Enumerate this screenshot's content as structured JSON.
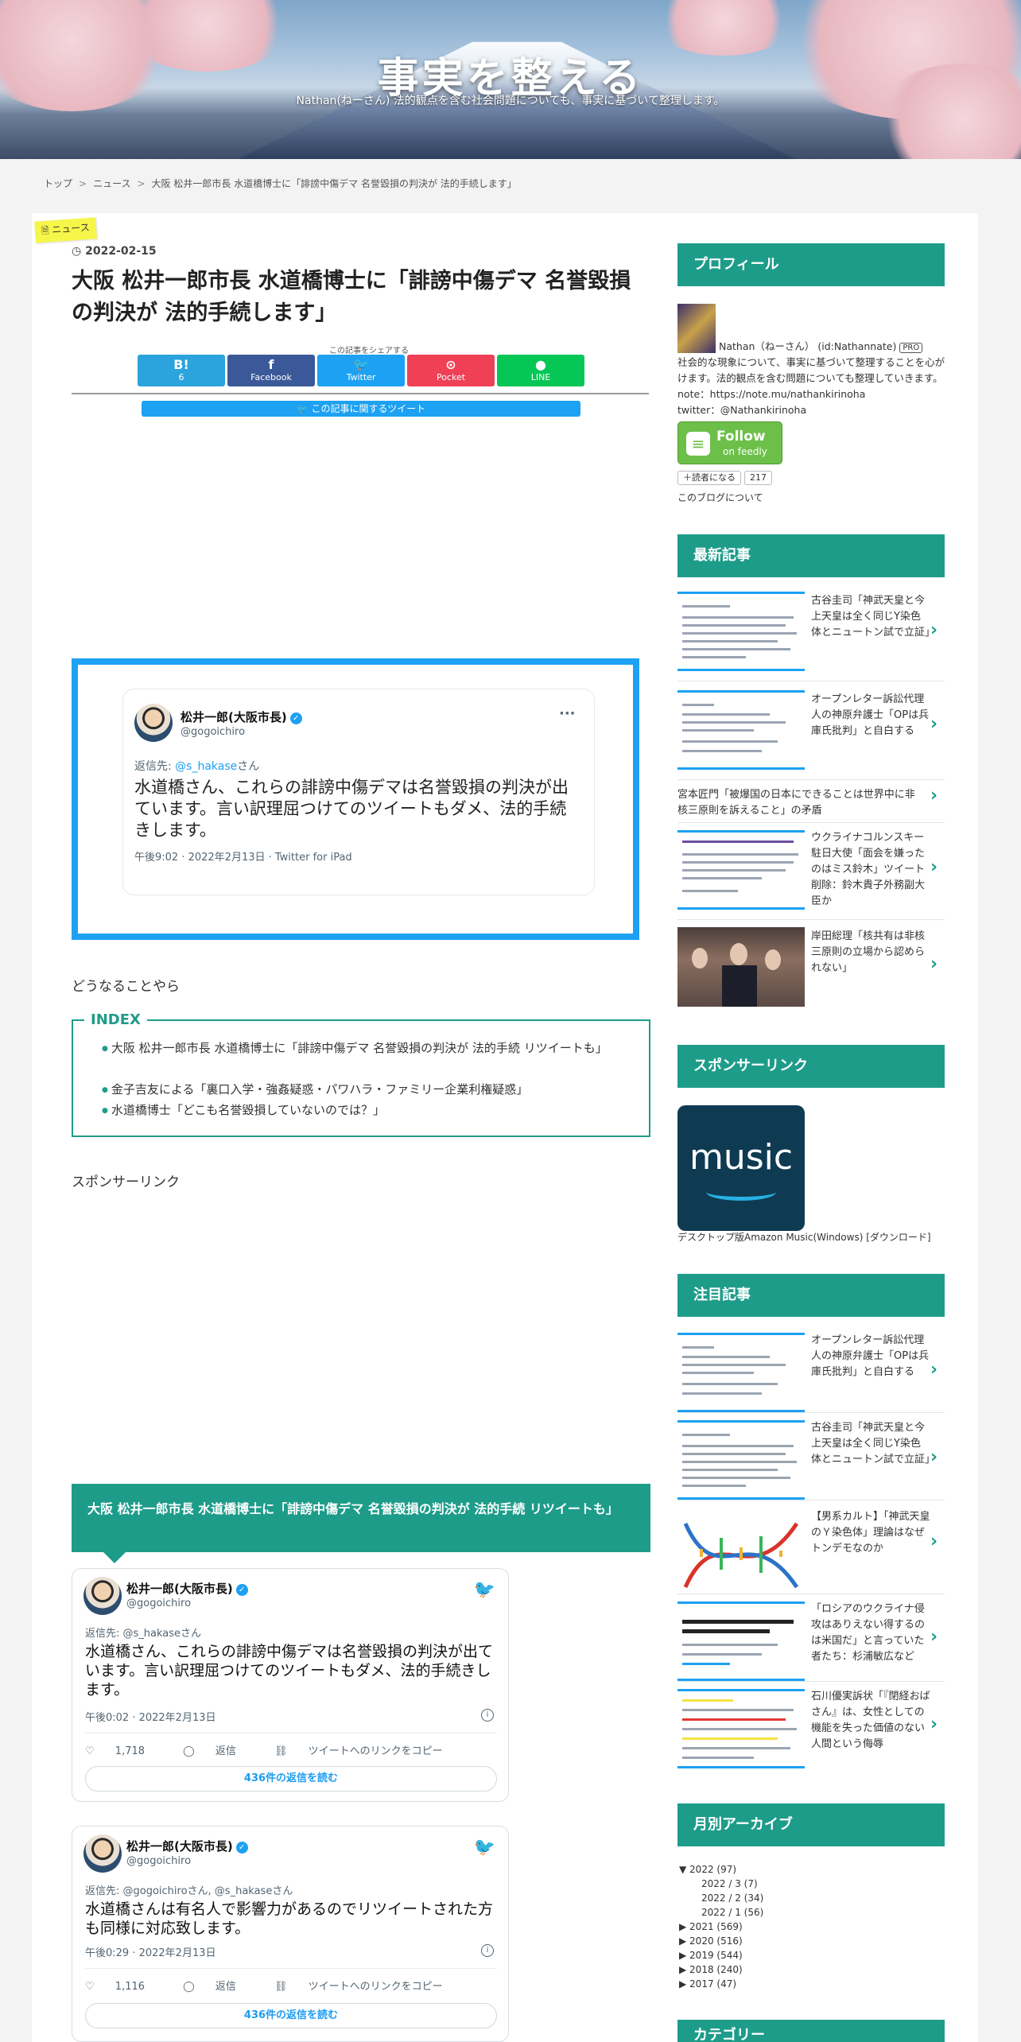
{
  "site": {
    "title": "事実を整える",
    "subtitle": "Nathan(ねーさん) 法的観点を含む社会問題についても、事実に基づいて整理します。"
  },
  "breadcrumb": [
    "トップ",
    "ニュース",
    "大阪 松井一郎市長 水道橋博士に「誹謗中傷デマ 名誉毀損の判決が 法的手続します」"
  ],
  "post": {
    "category": "ニュース",
    "date": "2022-02-15",
    "title": "大阪 松井一郎市長 水道橋博士に「誹謗中傷デマ 名誉毀損の判決が 法的手続します」",
    "share_caption": "この記事をシェアする",
    "share": [
      {
        "icon": "B!",
        "label": "6",
        "color": "#2ba3dc"
      },
      {
        "icon": "f",
        "label": "Facebook",
        "color": "#3b5998"
      },
      {
        "icon": "🐦",
        "label": "Twitter",
        "color": "#1da1f2"
      },
      {
        "icon": "⊙",
        "label": "Pocket",
        "color": "#ef4056"
      },
      {
        "icon": "●",
        "label": "LINE",
        "color": "#06c755"
      }
    ],
    "tweet_about": "この記事に関するツイート",
    "embed": {
      "name": "松井一郎(大阪市長)",
      "handle": "@gogoichiro",
      "reply_label": "返信先: ",
      "reply_to": "@s_hakase",
      "reply_suffix": "さん",
      "text": "水道橋さん、これらの誹謗中傷デマは名誉毀損の判決が出ています。言い訳理屈つけてのツイートもダメ、法的手続きします。",
      "meta": "午後9:02 · 2022年2月13日 · Twitter for iPad"
    },
    "intro": "どうなることやら",
    "index_title": "INDEX",
    "index": [
      "大阪 松井一郎市長 水道橋博士に「誹謗中傷デマ 名誉毀損の判決が 法的手続 リツイートも」",
      "金子吉友による「裏口入学・強姦疑惑・パワハラ・ファミリー企業利権疑惑」",
      "水道橋博士「どこも名誉毀損していないのでは？」"
    ],
    "sponsor": "スポンサーリンク",
    "section_heading": "大阪 松井一郎市長 水道橋博士に「誹謗中傷デマ 名誉毀損の判決が 法的手続 リツイートも」",
    "tweets": [
      {
        "name": "松井一郎(大阪市長)",
        "handle": "@gogoichiro",
        "reply": "返信先: @s_hakaseさん",
        "text": "水道橋さん、これらの誹謗中傷デマは名誉毀損の判決が出ています。言い訳理屈つけてのツイートもダメ、法的手続きします。",
        "meta": "午後0:02 · 2022年2月13日",
        "likes": "1,718",
        "reply_label": "返信",
        "copy_label": "ツイートへのリンクをコピー",
        "more": "436件の返信を読む"
      },
      {
        "name": "松井一郎(大阪市長)",
        "handle": "@gogoichiro",
        "reply": "返信先: @gogoichiroさん, @s_hakaseさん",
        "text": "水道橋さんは有名人で影響力があるのでリツイートされた方も同様に対応致します。",
        "meta": "午後0:29 · 2022年2月13日",
        "likes": "1,116",
        "reply_label": "返信",
        "copy_label": "ツイートへのリンクをコピー",
        "more": "436件の返信を読む"
      }
    ]
  },
  "sidebar": {
    "profile_heading": "プロフィール",
    "profile_name": "Nathan（ねーさん） (id:Nathannate)",
    "pro_badge": "PRO",
    "profile_desc_1": "社会的な現象について、事実に基づいて整理することを心がけます。法的観点を含む問題についても整理していきます。",
    "profile_note": "note：https://note.mu/nathankirinoha",
    "profile_twitter": "twitter：@Nathankirinoha",
    "feedly_follow": "Follow",
    "feedly_on": "on feedly",
    "reader_button": "読者になる",
    "reader_count": "217",
    "about_link": "このブログについて",
    "recent_heading": "最新記事",
    "recent": [
      "古谷圭司「神武天皇と今上天皇は全く同じY染色体とニュートン試で立証」",
      "オープンレター訴訟代理人の神原弁護士「OPは兵庫氏批判」と自白する",
      "宮本匠門「被爆国の日本にできることは世界中に非核三原則を訴えること」の矛盾",
      "ウクライナコルンスキー駐日大使「面会を嫌ったのはミス鈴木」ツイート削除：鈴木貴子外務副大臣か",
      "岸田総理「核共有は非核三原則の立場から認められない」"
    ],
    "sponsor_heading": "スポンサーリンク",
    "music_word": "music",
    "music_caption": "デスクトップ版Amazon Music(Windows) [ダウンロード]",
    "featured_heading": "注目記事",
    "featured": [
      "オープンレター訴訟代理人の神原弁護士「OPは兵庫氏批判」と自白する",
      "古谷圭司「神武天皇と今上天皇は全く同じY染色体とニュートン試で立証」",
      "【男系カルト】「神武天皇のＹ染色体」理論はなぜトンデモなのか",
      "「ロシアのウクライナ侵攻はありえない得するのは米国だ」と言っていた者たち：杉浦敏広など",
      "石川優実訴状「『閉経おばさん』は、女性としての機能を失った価値のない人間という侮辱"
    ],
    "archive_heading": "月別アーカイブ",
    "archive": [
      {
        "label": "▼ 2022 (97)",
        "indent": 0
      },
      {
        "label": "2022 / 3 (7)",
        "indent": 1
      },
      {
        "label": "2022 / 2 (34)",
        "indent": 1
      },
      {
        "label": "2022 / 1 (56)",
        "indent": 1
      },
      {
        "label": "▶ 2021 (569)",
        "indent": 0
      },
      {
        "label": "▶ 2020 (516)",
        "indent": 0
      },
      {
        "label": "▶ 2019 (544)",
        "indent": 0
      },
      {
        "label": "▶ 2018 (240)",
        "indent": 0
      },
      {
        "label": "▶ 2017 (47)",
        "indent": 0
      }
    ],
    "category_heading": "カテゴリー"
  }
}
